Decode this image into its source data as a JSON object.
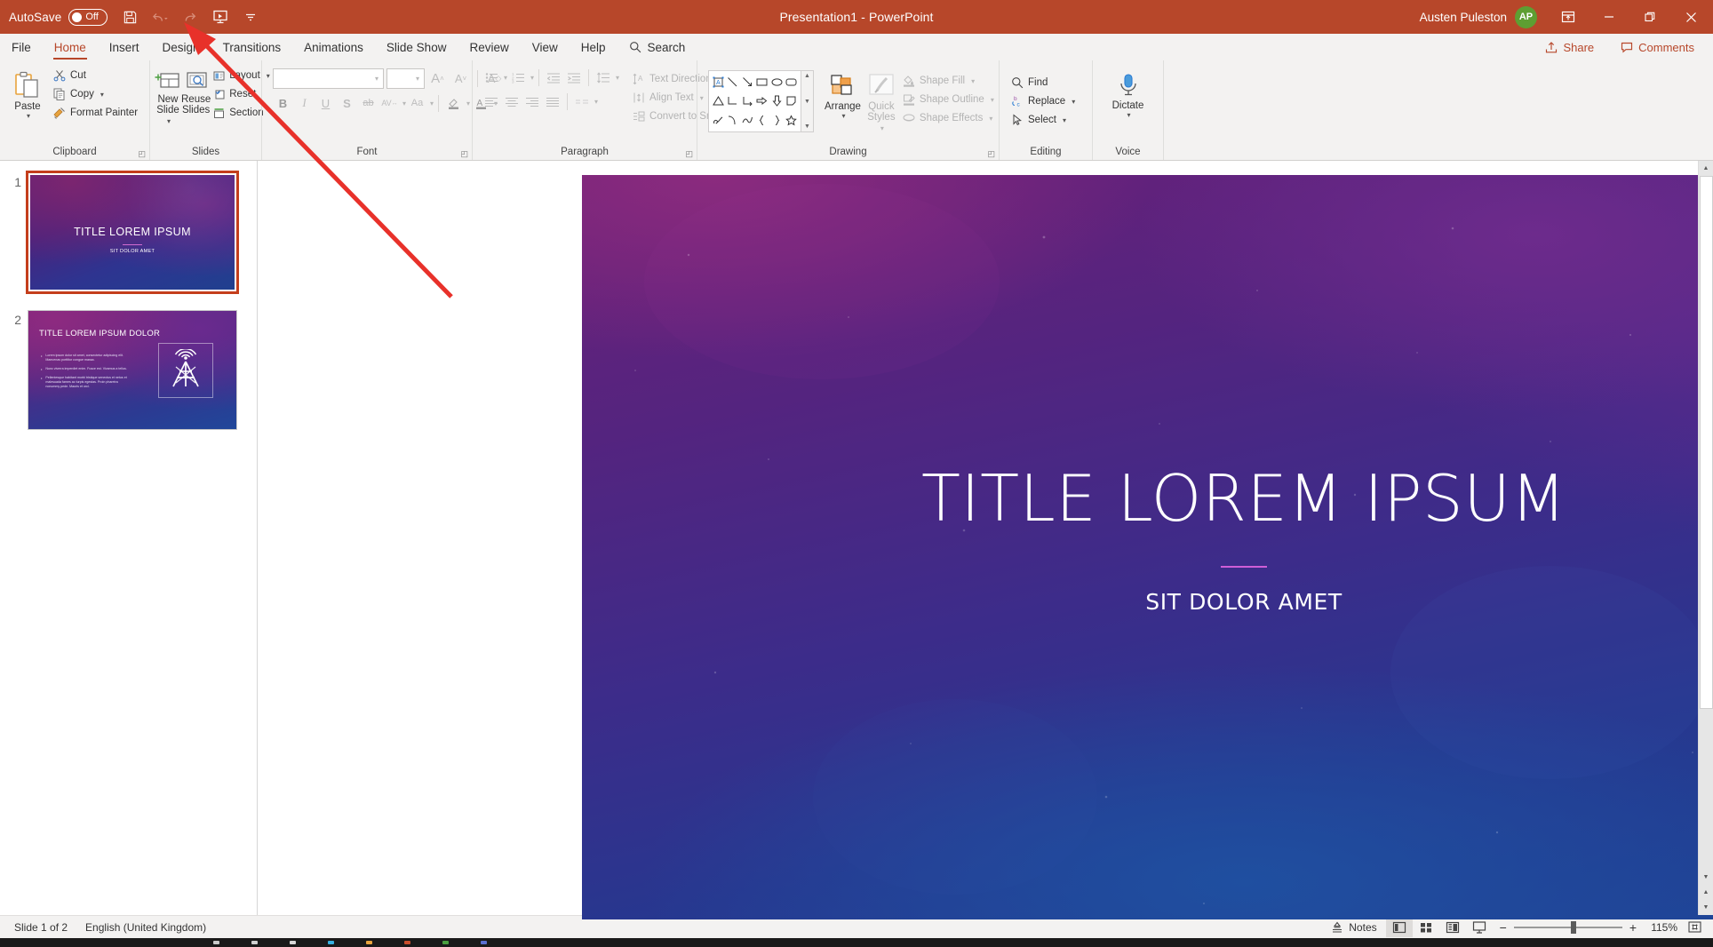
{
  "titlebar": {
    "autosave_label": "AutoSave",
    "autosave_state": "Off",
    "document_title": "Presentation1",
    "app_name": "PowerPoint",
    "title_separator": "-",
    "user_name": "Austen Puleston",
    "user_initials": "AP",
    "qat_icons": [
      "save-icon",
      "undo-icon",
      "redo-icon",
      "start-from-beginning-icon",
      "customize-quick-access-toolbar-icon"
    ],
    "window_buttons": [
      "ribbon-display-options",
      "minimize",
      "restore",
      "close"
    ],
    "accent_color": "#b7472a",
    "avatar_color": "#5e9e32"
  },
  "tabs": [
    {
      "label": "File",
      "active": false
    },
    {
      "label": "Home",
      "active": true
    },
    {
      "label": "Insert",
      "active": false
    },
    {
      "label": "Design",
      "active": false
    },
    {
      "label": "Transitions",
      "active": false
    },
    {
      "label": "Animations",
      "active": false
    },
    {
      "label": "Slide Show",
      "active": false
    },
    {
      "label": "Review",
      "active": false
    },
    {
      "label": "View",
      "active": false
    },
    {
      "label": "Help",
      "active": false
    }
  ],
  "search": {
    "label": "Search",
    "placeholder": "Search"
  },
  "share": {
    "share_label": "Share",
    "comments_label": "Comments"
  },
  "ribbon": {
    "groups": [
      {
        "name": "Clipboard",
        "label": "Clipboard",
        "has_launcher": true,
        "big": [
          {
            "label": "Paste",
            "has_caret": true,
            "disabled": false
          }
        ],
        "small": [
          {
            "label": "Cut",
            "icon": "scissors-icon",
            "disabled": false,
            "caret": false
          },
          {
            "label": "Copy",
            "icon": "copy-icon",
            "disabled": false,
            "caret": true
          },
          {
            "label": "Format Painter",
            "icon": "format-painter-icon",
            "disabled": false,
            "caret": false
          }
        ]
      },
      {
        "name": "Slides",
        "label": "Slides",
        "has_launcher": false,
        "big": [
          {
            "label": "New Slide",
            "has_caret": true,
            "disabled": false
          },
          {
            "label": "Reuse Slides",
            "has_caret": false,
            "disabled": false
          }
        ],
        "small": [
          {
            "label": "Layout",
            "icon": "layout-icon",
            "disabled": false,
            "caret": true
          },
          {
            "label": "Reset",
            "icon": "reset-icon",
            "disabled": false,
            "caret": false
          },
          {
            "label": "Section",
            "icon": "section-icon",
            "disabled": false,
            "caret": true
          }
        ]
      },
      {
        "name": "Font",
        "label": "Font",
        "has_launcher": true,
        "font_name_value": "",
        "font_size_value": "",
        "buttons_row1": [
          "increase-font-size",
          "decrease-font-size",
          "clear-all-formatting"
        ],
        "buttons_row2": [
          "bold",
          "italic",
          "underline",
          "text-shadow",
          "strikethrough",
          "character-spacing",
          "change-case",
          "text-highlight-color",
          "font-color"
        ]
      },
      {
        "name": "Paragraph",
        "label": "Paragraph",
        "has_launcher": true,
        "small": [
          {
            "label": "Text Direction",
            "icon": "text-direction-icon",
            "disabled": true,
            "caret": true
          },
          {
            "label": "Align Text",
            "icon": "align-text-icon",
            "disabled": true,
            "caret": true
          },
          {
            "label": "Convert to SmartArt",
            "icon": "smartart-icon",
            "disabled": true,
            "caret": true
          }
        ]
      },
      {
        "name": "Drawing",
        "label": "Drawing",
        "has_launcher": true,
        "big": [
          {
            "label": "Arrange",
            "has_caret": true,
            "disabled": false
          },
          {
            "label": "Quick Styles",
            "has_caret": true,
            "disabled": true
          }
        ],
        "small": [
          {
            "label": "Shape Fill",
            "icon": "shape-fill-icon",
            "disabled": true,
            "caret": true
          },
          {
            "label": "Shape Outline",
            "icon": "shape-outline-icon",
            "disabled": true,
            "caret": true
          },
          {
            "label": "Shape Effects",
            "icon": "shape-effects-icon",
            "disabled": true,
            "caret": true
          }
        ]
      },
      {
        "name": "Editing",
        "label": "Editing",
        "has_launcher": false,
        "small": [
          {
            "label": "Find",
            "icon": "find-icon",
            "disabled": false,
            "caret": false
          },
          {
            "label": "Replace",
            "icon": "replace-icon",
            "disabled": false,
            "caret": true
          },
          {
            "label": "Select",
            "icon": "select-icon",
            "disabled": false,
            "caret": true
          }
        ]
      },
      {
        "name": "Voice",
        "label": "Voice",
        "has_launcher": false,
        "big": [
          {
            "label": "Dictate",
            "has_caret": true,
            "disabled": false
          }
        ]
      }
    ]
  },
  "thumbnails": [
    {
      "number": "1",
      "selected": true,
      "title": "TITLE LOREM IPSUM",
      "subtitle": "SIT DOLOR AMET"
    },
    {
      "number": "2",
      "selected": false,
      "title": "TITLE LOREM IPSUM DOLOR",
      "bullets": [
        "Lorem ipsum dolor sit amet, consectetur adipiscing elit. Maecenas porttitor congue massa.",
        "Nunc viverra imperdiet enim. Fusce est. Vivamus a tellus.",
        "Pellentesque habitant morbi tristique senectus et netus et malesuada fames ac turpis egestas. Proin pharetra nonummy pede. Mauris et orci."
      ],
      "icon": "radio-tower-icon"
    }
  ],
  "slide": {
    "title": "TITLE LOREM IPSUM",
    "subtitle": "SIT DOLOR AMET",
    "divider_color": "#cf5ed8"
  },
  "statusbar": {
    "slide_counter": "Slide 1 of 2",
    "language": "English (United Kingdom)",
    "notes_label": "Notes",
    "views": [
      "normal-view",
      "slide-sorter-view",
      "reading-view",
      "slide-show-view"
    ],
    "active_view": "normal-view",
    "zoom_out": "−",
    "zoom_in": "+",
    "zoom_value": "115%",
    "fit_to_window": "fit-slide-to-window-icon"
  },
  "annotation": {
    "type": "red-arrow",
    "points_to": "start-from-beginning-icon",
    "color": "#e8312a"
  }
}
